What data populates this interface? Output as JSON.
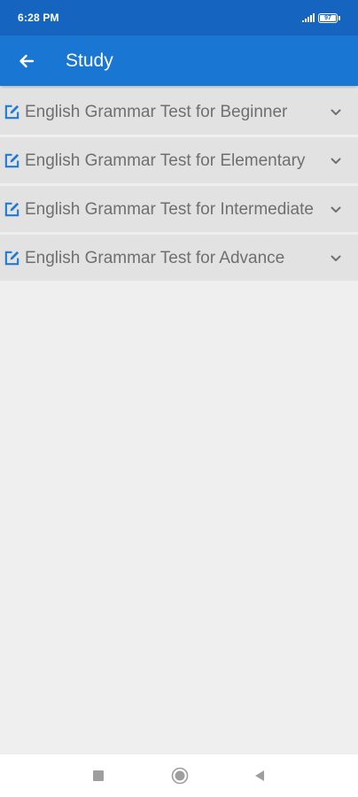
{
  "status_bar": {
    "time": "6:28 PM",
    "battery_level": "97",
    "icons": [
      "signal-icon",
      "battery-icon"
    ]
  },
  "app_bar": {
    "title": "Study",
    "back_icon": "arrow-left-icon"
  },
  "list": {
    "items": [
      {
        "label": "English Grammar Test for Beginner",
        "icon": "edit-icon",
        "expand_icon": "chevron-down-icon"
      },
      {
        "label": "English Grammar Test for Elementary",
        "icon": "edit-icon",
        "expand_icon": "chevron-down-icon"
      },
      {
        "label": "English Grammar Test for Intermediate",
        "icon": "edit-icon",
        "expand_icon": "chevron-down-icon"
      },
      {
        "label": "English Grammar Test for Advance",
        "icon": "edit-icon",
        "expand_icon": "chevron-down-icon"
      }
    ]
  },
  "nav_bar": {
    "buttons": [
      "recents-square-icon",
      "home-circle-icon",
      "back-triangle-icon"
    ]
  },
  "colors": {
    "status_bar": "#1565c0",
    "app_bar": "#1976d2",
    "accent_icon": "#1e7ad6",
    "list_item_bg": "#e2e2e2",
    "list_text": "#6f6f6f",
    "page_bg": "#efefef",
    "nav_bar_bg": "#ffffff",
    "nav_icon": "#9e9e9e"
  }
}
